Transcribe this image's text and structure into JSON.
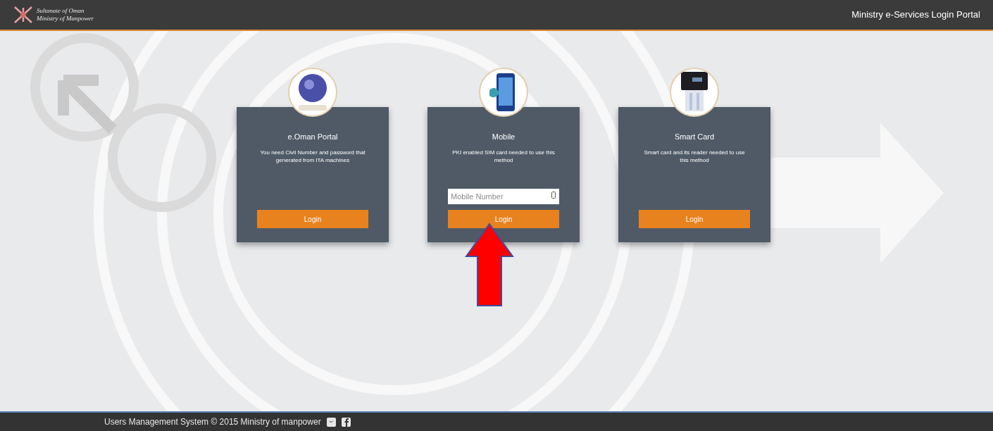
{
  "header": {
    "logo_lines": [
      "Sultanate of Oman",
      "Ministry of Manpower"
    ],
    "title": "Ministry e-Services Login Portal"
  },
  "cards": [
    {
      "kind": "eoman",
      "title": "e.Oman Portal",
      "description": "You need Civil Number and password that generated from ITA machines",
      "button": "Login"
    },
    {
      "kind": "mobile",
      "title": "Mobile",
      "description": "PKI enabled SIM card needed to use this method",
      "input": {
        "placeholder": "Mobile Number"
      },
      "button": "Login"
    },
    {
      "kind": "smartcard",
      "title": "Smart Card",
      "description": "Smart card and its reader needed to use this method",
      "button": "Login"
    }
  ],
  "footer": {
    "text": "Users Management System © 2015 Ministry of manpower"
  }
}
